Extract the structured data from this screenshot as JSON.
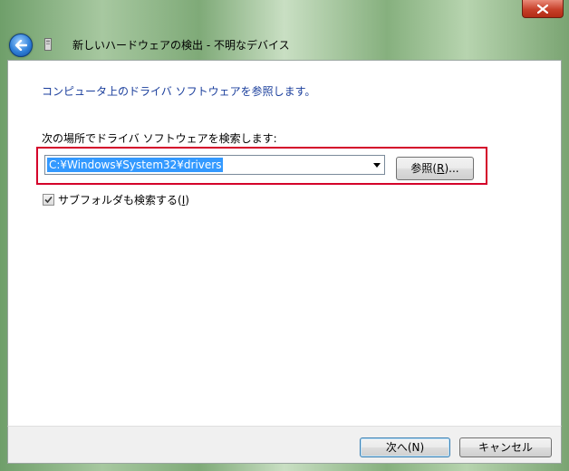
{
  "window": {
    "title": "新しいハードウェアの検出 - 不明なデバイス",
    "close_label": "Close"
  },
  "main": {
    "heading": "コンピュータ上のドライバ ソフトウェアを参照します。",
    "location_label": "次の場所でドライバ ソフトウェアを検索します:",
    "path_value": "C:¥Windows¥System32¥drivers",
    "browse_label_prefix": "参照(",
    "browse_label_key": "R",
    "browse_label_suffix": ")...",
    "include_subfolders_prefix": "サブフォルダも検索する(",
    "include_subfolders_key": "I",
    "include_subfolders_suffix": ")",
    "include_subfolders_checked": true
  },
  "footer": {
    "next_label": "次へ(N)",
    "cancel_label": "キャンセル"
  },
  "colors": {
    "heading": "#1a3e9c",
    "highlight": "#d4002a",
    "selection": "#3399ff"
  },
  "icons": {
    "back": "back-arrow-icon",
    "wizard": "hardware-wizard-icon",
    "close": "close-icon",
    "check": "checkmark-icon",
    "dropdown": "chevron-down-icon"
  }
}
